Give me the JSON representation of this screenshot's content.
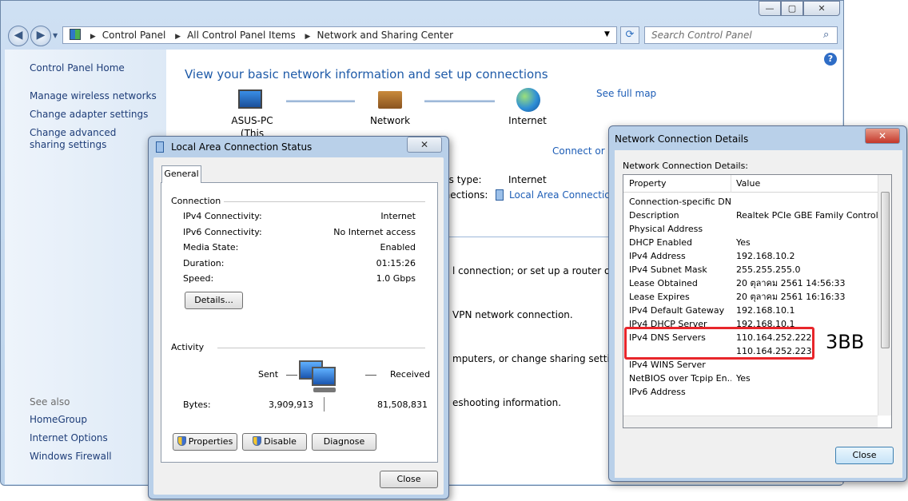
{
  "window": {
    "caption_buttons": [
      "—",
      "▢",
      "✕"
    ],
    "breadcrumb": [
      "Control Panel",
      "All Control Panel Items",
      "Network and Sharing Center"
    ],
    "search_placeholder": "Search Control Panel",
    "help_glyph": "?"
  },
  "sidebar": {
    "home": "Control Panel Home",
    "tasks": [
      "Manage wireless networks",
      "Change adapter settings",
      "Change advanced sharing settings"
    ],
    "see_also_label": "See also",
    "see_also": [
      "HomeGroup",
      "Internet Options",
      "Windows Firewall"
    ]
  },
  "content": {
    "heading": "View your basic network information and set up connections",
    "see_full_map": "See full map",
    "map": [
      {
        "label": "ASUS-PC",
        "sublabel": "(This computer)"
      },
      {
        "label": "Network"
      },
      {
        "label": "Internet"
      }
    ],
    "connect_link": "Connect or d",
    "access_type_label": "ess type:",
    "access_type_value": "Internet",
    "connections_label": "nnections:",
    "connections_value": "Local Area Connection",
    "tasks": [
      "l connection; or set up a router or acc",
      "VPN network connection.",
      "mputers, or change sharing settings.",
      "eshooting information."
    ]
  },
  "status_dialog": {
    "title": "Local Area Connection Status",
    "tab": "General",
    "connection_label": "Connection",
    "rows": [
      {
        "k": "IPv4 Connectivity:",
        "v": "Internet"
      },
      {
        "k": "IPv6 Connectivity:",
        "v": "No Internet access"
      },
      {
        "k": "Media State:",
        "v": "Enabled"
      },
      {
        "k": "Duration:",
        "v": "01:15:26"
      },
      {
        "k": "Speed:",
        "v": "1.0 Gbps"
      }
    ],
    "details_button": "Details...",
    "activity_label": "Activity",
    "sent_label": "Sent",
    "received_label": "Received",
    "bytes_label": "Bytes:",
    "bytes_sent": "3,909,913",
    "bytes_received": "81,508,831",
    "properties_button": "Properties",
    "disable_button": "Disable",
    "diagnose_button": "Diagnose",
    "close_button": "Close",
    "close_glyph": "✕"
  },
  "details_dialog": {
    "title": "Network Connection Details",
    "caption": "Network Connection Details:",
    "col_property": "Property",
    "col_value": "Value",
    "rows": [
      {
        "p": "Connection-specific DN...",
        "v": ""
      },
      {
        "p": "Description",
        "v": "Realtek PCIe GBE Family Controller"
      },
      {
        "p": "Physical Address",
        "v": ""
      },
      {
        "p": "DHCP Enabled",
        "v": "Yes"
      },
      {
        "p": "IPv4 Address",
        "v": "192.168.10.2"
      },
      {
        "p": "IPv4 Subnet Mask",
        "v": "255.255.255.0"
      },
      {
        "p": "Lease Obtained",
        "v": "20 ตุลาคม 2561 14:56:33"
      },
      {
        "p": "Lease Expires",
        "v": "20 ตุลาคม 2561 16:16:33"
      },
      {
        "p": "IPv4 Default Gateway",
        "v": "192.168.10.1"
      },
      {
        "p": "IPv4 DHCP Server",
        "v": "192.168.10.1"
      },
      {
        "p": "IPv4 DNS Servers",
        "v": "110.164.252.222"
      },
      {
        "p": "",
        "v": "110.164.252.223"
      },
      {
        "p": "IPv4 WINS Server",
        "v": ""
      },
      {
        "p": "NetBIOS over Tcpip En...",
        "v": "Yes"
      },
      {
        "p": "IPv6 Address",
        "v": ""
      }
    ],
    "close_button": "Close",
    "close_glyph": "✕",
    "annotation": "3BB",
    "annotation_color": "#e8262b"
  }
}
